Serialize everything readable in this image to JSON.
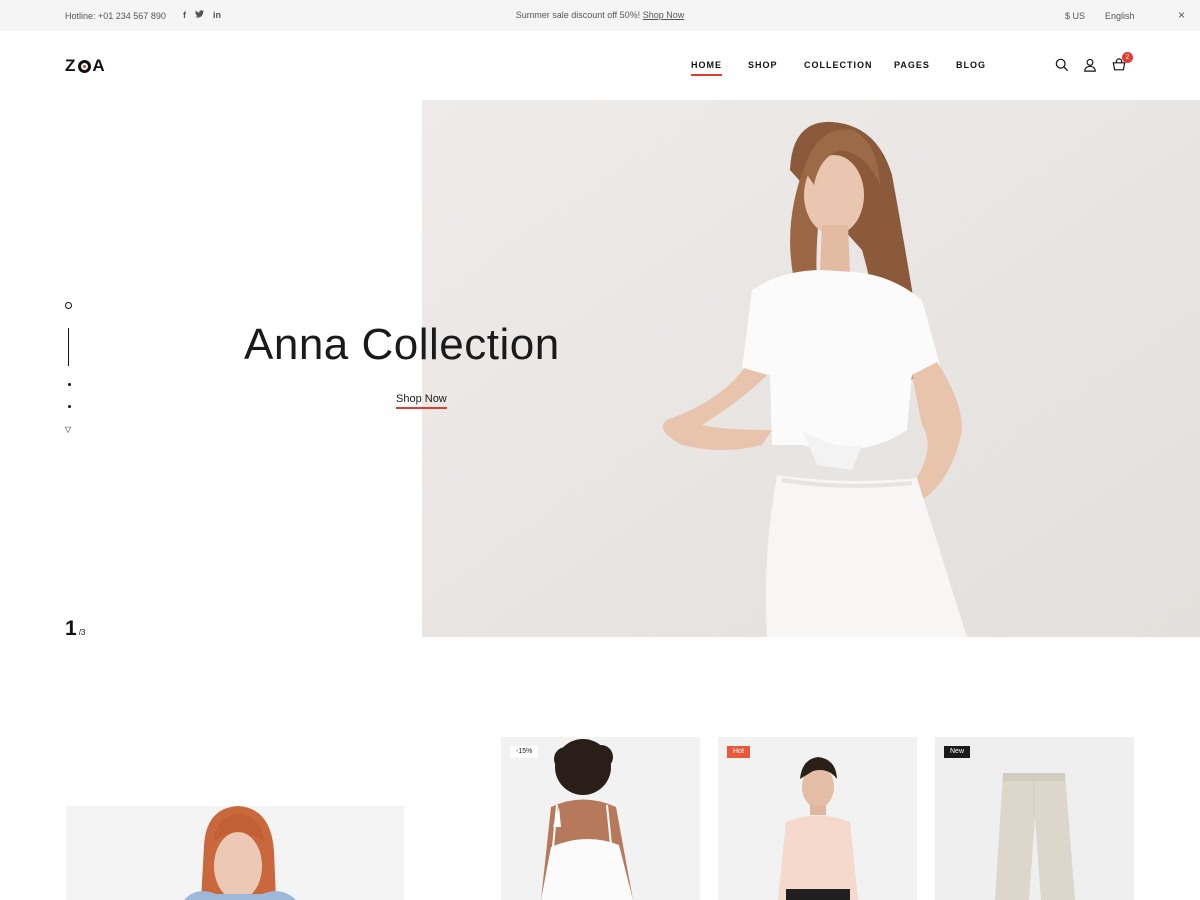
{
  "topbar": {
    "hotline": "Hotline: +01 234 567 890",
    "social": [
      "f",
      "t",
      "in"
    ],
    "promo_text": "Summer sale discount off 50%!",
    "promo_link": "Shop Now",
    "currency": "$ US",
    "language": "English",
    "close_icon": "×"
  },
  "header": {
    "logo_left": "Z",
    "logo_right": "A",
    "nav": [
      "HOME",
      "SHOP",
      "COLLECTION",
      "PAGES",
      "BLOG"
    ],
    "active_nav": "HOME",
    "cart_count": "2"
  },
  "hero": {
    "title": "Anna Collection",
    "button": "Shop Now",
    "current_slide": "1",
    "total_slides": "/3"
  },
  "products": [
    {
      "badge": "-15%",
      "badge_style": "light"
    },
    {
      "badge": "Hot",
      "badge_style": "accent"
    },
    {
      "badge": "New",
      "badge_style": "dark"
    }
  ],
  "colors": {
    "accent": "#e33b2e",
    "dark": "#1a1a1a",
    "topbar_bg": "#f5f5f5"
  }
}
